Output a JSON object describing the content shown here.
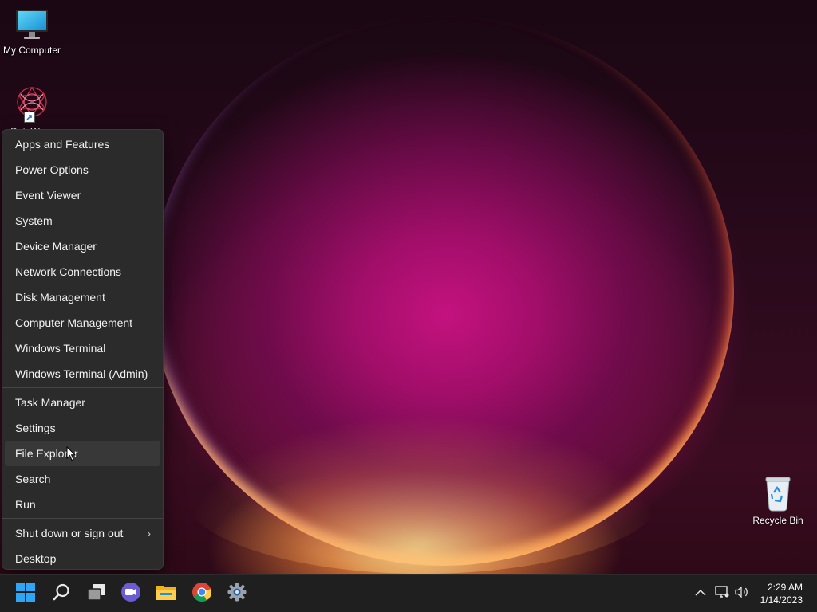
{
  "desktop": {
    "icons": [
      {
        "label": "My Computer",
        "icon": "monitor-icon"
      },
      {
        "label": "DataWarp",
        "icon": "spiral-app-icon"
      },
      {
        "label": "Recycle Bin",
        "icon": "recycle-bin-icon"
      }
    ]
  },
  "menu": {
    "group1": [
      {
        "label": "Apps and Features"
      },
      {
        "label": "Power Options"
      },
      {
        "label": "Event Viewer"
      },
      {
        "label": "System"
      },
      {
        "label": "Device Manager"
      },
      {
        "label": "Network Connections"
      },
      {
        "label": "Disk Management"
      },
      {
        "label": "Computer Management"
      },
      {
        "label": "Windows Terminal"
      },
      {
        "label": "Windows Terminal (Admin)"
      }
    ],
    "group2": [
      {
        "label": "Task Manager"
      },
      {
        "label": "Settings"
      },
      {
        "label": "File Explorer"
      },
      {
        "label": "Search"
      },
      {
        "label": "Run"
      }
    ],
    "group3": [
      {
        "label": "Shut down or sign out",
        "chevron": "›"
      },
      {
        "label": "Desktop"
      }
    ],
    "hovered": "File Explorer"
  },
  "taskbar": {
    "apps": [
      {
        "icon": "windows-start-icon"
      },
      {
        "icon": "search-icon"
      },
      {
        "icon": "task-view-icon"
      },
      {
        "icon": "teams-chat-icon"
      },
      {
        "icon": "file-explorer-icon"
      },
      {
        "icon": "chrome-icon"
      },
      {
        "icon": "settings-gear-icon"
      }
    ],
    "tray": {
      "time": "2:29 AM",
      "date": "1/14/2023"
    }
  },
  "colors": {
    "menu_bg": "#2b2b2b",
    "taskbar_bg": "#1f1f1f",
    "accent_blue": "#0078d4"
  }
}
